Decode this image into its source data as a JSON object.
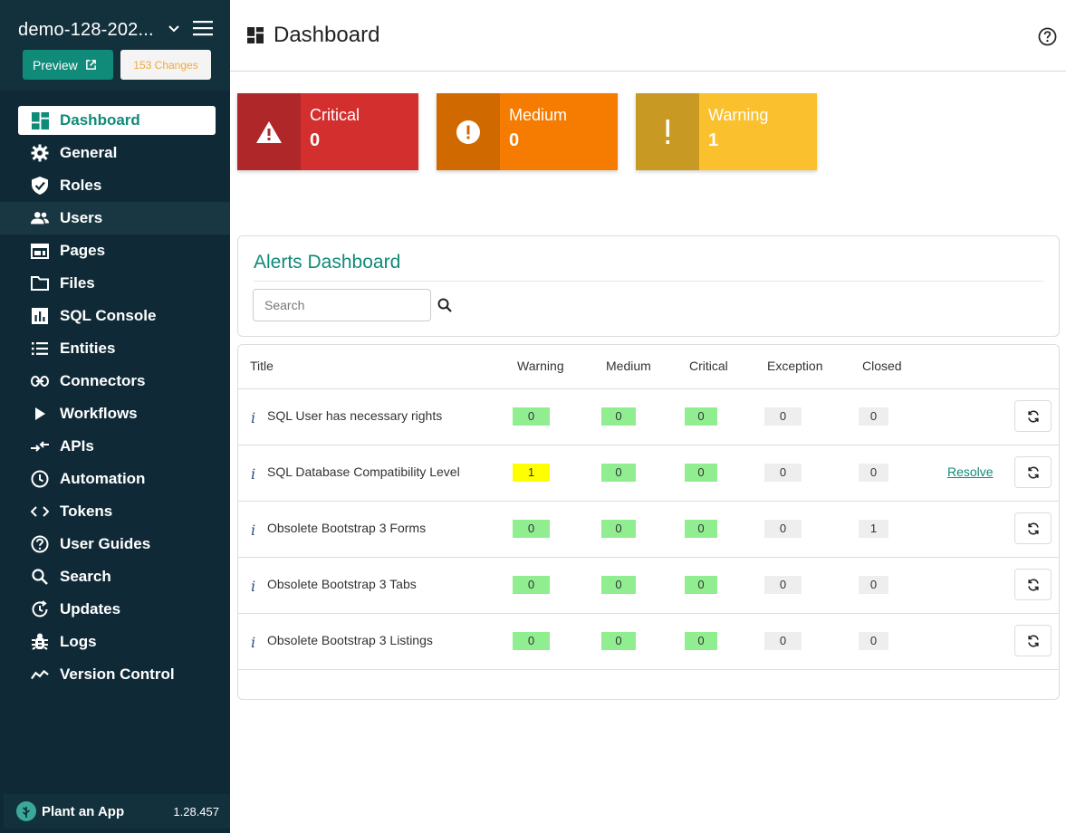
{
  "sidebar": {
    "site_name": "demo-128-202...",
    "preview_label": "Preview",
    "changes_label": "153 Changes",
    "items": [
      {
        "label": "Dashboard",
        "icon": "dashboard-icon"
      },
      {
        "label": "General",
        "icon": "gear-icon"
      },
      {
        "label": "Roles",
        "icon": "shield-check-icon"
      },
      {
        "label": "Users",
        "icon": "users-icon"
      },
      {
        "label": "Pages",
        "icon": "page-window-icon"
      },
      {
        "label": "Files",
        "icon": "folder-icon"
      },
      {
        "label": "SQL Console",
        "icon": "bar-chart-icon"
      },
      {
        "label": "Entities",
        "icon": "list-icon"
      },
      {
        "label": "Connectors",
        "icon": "link-icon"
      },
      {
        "label": "Workflows",
        "icon": "play-icon"
      },
      {
        "label": "APIs",
        "icon": "api-arrows-icon"
      },
      {
        "label": "Automation",
        "icon": "clock-icon"
      },
      {
        "label": "Tokens",
        "icon": "code-icon"
      },
      {
        "label": "User Guides",
        "icon": "help-circle-icon"
      },
      {
        "label": "Search",
        "icon": "search-icon"
      },
      {
        "label": "Updates",
        "icon": "update-icon"
      },
      {
        "label": "Logs",
        "icon": "bug-icon"
      },
      {
        "label": "Version Control",
        "icon": "timeline-icon"
      }
    ],
    "footer": {
      "brand": "Plant an App",
      "version": "1.28.457"
    }
  },
  "header": {
    "title": "Dashboard"
  },
  "cards": [
    {
      "label": "Critical",
      "value": "0",
      "color": "#d32f2f",
      "icon_bg": "#b0272a"
    },
    {
      "label": "Medium",
      "value": "0",
      "color": "#f57c00",
      "icon_bg": "#d06a00"
    },
    {
      "label": "Warning",
      "value": "1",
      "color": "#fbc02d",
      "icon_bg": "#c89a24"
    }
  ],
  "alerts": {
    "title": "Alerts Dashboard",
    "search_placeholder": "Search"
  },
  "table": {
    "headers": [
      "Title",
      "Warning",
      "Medium",
      "Critical",
      "Exception",
      "Closed"
    ],
    "resolve_label": "Resolve",
    "rows": [
      {
        "title": "SQL User has necessary rights",
        "warning": "0",
        "medium": "0",
        "critical": "0",
        "exception": "0",
        "closed": "0"
      },
      {
        "title": "SQL Database Compatibility Level",
        "warning": "1",
        "medium": "0",
        "critical": "0",
        "exception": "0",
        "closed": "0"
      },
      {
        "title": "Obsolete Bootstrap 3 Forms",
        "warning": "0",
        "medium": "0",
        "critical": "0",
        "exception": "0",
        "closed": "1"
      },
      {
        "title": "Obsolete Bootstrap 3 Tabs",
        "warning": "0",
        "medium": "0",
        "critical": "0",
        "exception": "0",
        "closed": "0"
      },
      {
        "title": "Obsolete Bootstrap 3 Listings",
        "warning": "0",
        "medium": "0",
        "critical": "0",
        "exception": "0",
        "closed": "0"
      }
    ]
  },
  "colors": {
    "accent": "#108a79",
    "sidebar_bg": "#0f2a36",
    "badge_green": "#90ee90",
    "badge_yellow": "#ffff00",
    "badge_grey": "#eeeeee"
  }
}
